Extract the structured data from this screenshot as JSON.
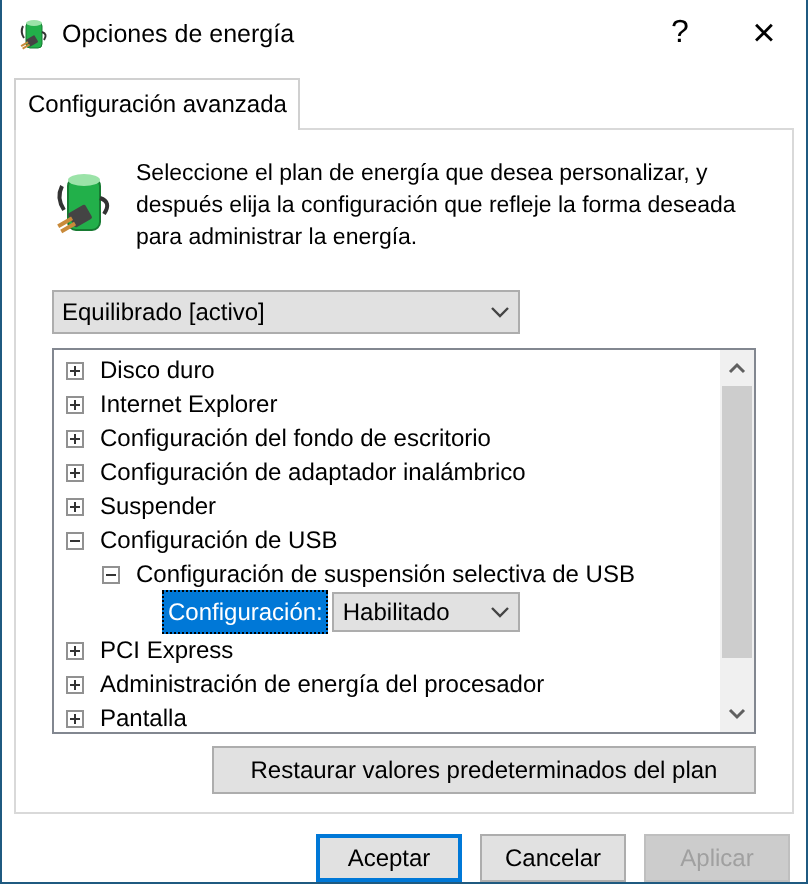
{
  "window": {
    "title": "Opciones de energía",
    "help": "?",
    "close": "×"
  },
  "tabs": [
    {
      "label": "Configuración avanzada",
      "selected": true
    }
  ],
  "description": "Seleccione el plan de energía que desea personalizar, y después elija la configuración que refleje la forma deseada para administrar la energía.",
  "plan_select": {
    "value": "Equilibrado [activo]"
  },
  "tree": [
    {
      "kind": "group",
      "label": "Disco duro",
      "expanded": false
    },
    {
      "kind": "group",
      "label": "Internet Explorer",
      "expanded": false
    },
    {
      "kind": "group",
      "label": "Configuración del fondo de escritorio",
      "expanded": false
    },
    {
      "kind": "group",
      "label": "Configuración de adaptador inalámbrico",
      "expanded": false
    },
    {
      "kind": "group",
      "label": "Suspender",
      "expanded": false
    },
    {
      "kind": "group",
      "label": "Configuración de USB",
      "expanded": true,
      "children": [
        {
          "kind": "group",
          "label": "Configuración de suspensión selectiva de USB",
          "expanded": true,
          "children": [
            {
              "kind": "setting",
              "label": "Configuración:",
              "selected": true,
              "value": "Habilitado"
            }
          ]
        }
      ]
    },
    {
      "kind": "group",
      "label": "PCI Express",
      "expanded": false
    },
    {
      "kind": "group",
      "label": "Administración de energía del procesador",
      "expanded": false
    },
    {
      "kind": "group",
      "label": "Pantalla",
      "expanded": false
    }
  ],
  "restore_button": "Restaurar valores predeterminados del plan",
  "buttons": [
    {
      "label": "Aceptar",
      "default": true,
      "disabled": false
    },
    {
      "label": "Cancelar",
      "default": false,
      "disabled": false
    },
    {
      "label": "Aplicar",
      "default": false,
      "disabled": true
    }
  ]
}
